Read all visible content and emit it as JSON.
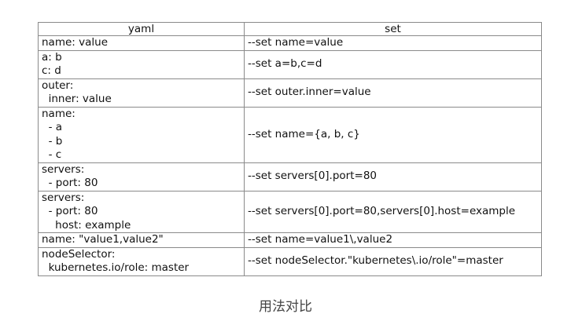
{
  "table": {
    "headers": [
      "yaml",
      "set"
    ],
    "rows": [
      {
        "yaml": "name: value",
        "set": "--set name=value"
      },
      {
        "yaml": "a: b\nc: d",
        "set": "--set a=b,c=d"
      },
      {
        "yaml": "outer:\n  inner: value",
        "set": "--set outer.inner=value"
      },
      {
        "yaml": "name:\n  - a\n  - b\n  - c",
        "set": "--set name={a, b, c}"
      },
      {
        "yaml": "servers:\n  - port: 80",
        "set": "--set servers[0].port=80"
      },
      {
        "yaml": "servers:\n  - port: 80\n    host: example",
        "set": "--set servers[0].port=80,servers[0].host=example"
      },
      {
        "yaml": "name: \"value1,value2\"",
        "set": "--set name=value1\\,value2"
      },
      {
        "yaml": "nodeSelector:\n  kubernetes.io/role: master",
        "set": "--set nodeSelector.\"kubernetes\\.io/role\"=master"
      }
    ]
  },
  "caption": "用法对比"
}
